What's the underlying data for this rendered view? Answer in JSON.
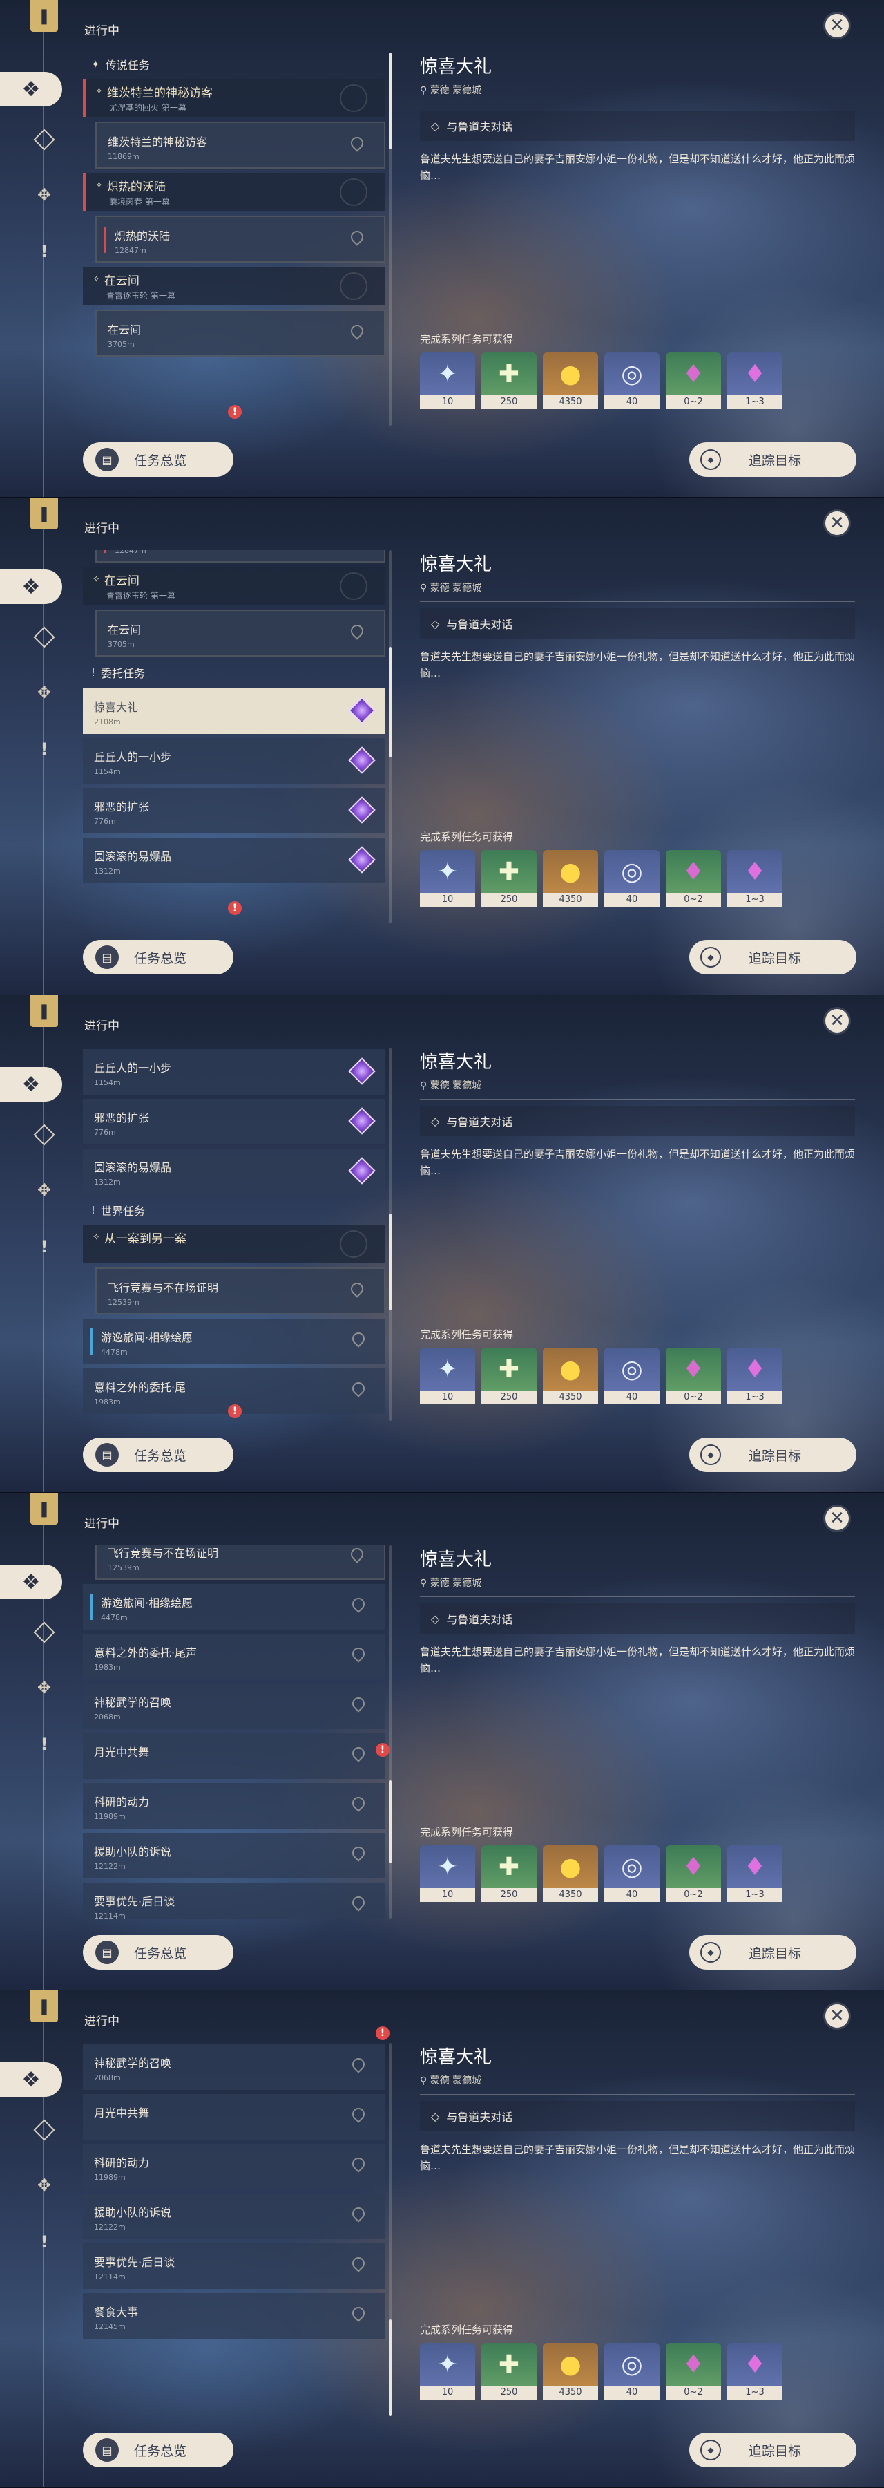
{
  "header": {
    "status_title": "进行中"
  },
  "sections": {
    "legend": "传说任务",
    "commission": "委托任务",
    "world": "世界任务"
  },
  "quests": {
    "vennessa": {
      "title": "维茨特兰的神秘访客",
      "sub": "尤涅基的回火 第一幕",
      "item": "维茨特兰的神秘访客",
      "dist": "11869m"
    },
    "scorching": {
      "title": "炽热的沃陆",
      "sub": "蘑境茵春 第一幕",
      "item": "炽热的沃陆",
      "dist": "12847m"
    },
    "cloud": {
      "title": "在云间",
      "sub": "青霄逐玉轮 第一幕",
      "item": "在云间",
      "dist": "3705m"
    },
    "surprise": {
      "title": "惊喜大礼",
      "dist": "2108m"
    },
    "hilichurl": {
      "title": "丘丘人的一小步",
      "dist": "1154m"
    },
    "evil": {
      "title": "邪恶的扩张",
      "dist": "776m"
    },
    "boom": {
      "title": "圆滚滚的易爆品",
      "dist": "1312m"
    },
    "case": {
      "title": "从一案到另一案"
    },
    "flight": {
      "title": "飞行竞赛与不在场证明",
      "dist": "12539m"
    },
    "travel": {
      "title": "游逸旅闻·相缘绘愿",
      "dist": "4478m"
    },
    "unexpected": {
      "title": "意料之外的委托·尾声",
      "title_cut": "意料之外的委托·尾",
      "dist": "1983m"
    },
    "martial": {
      "title": "神秘武学的召唤",
      "dist": "2068m"
    },
    "moon": {
      "title": "月光中共舞"
    },
    "research": {
      "title": "科研的动力",
      "dist": "11989m"
    },
    "aid": {
      "title": "援助小队的诉说",
      "dist": "12122m"
    },
    "priority": {
      "title": "要事优先·后日谈",
      "title_cut": "要事优先·后日谈",
      "dist": "12114m"
    },
    "feast": {
      "title": "餐食大事",
      "dist": "12145m"
    }
  },
  "detail": {
    "title": "惊喜大礼",
    "location": "蒙德 蒙德城",
    "objective": "与鲁道夫对话",
    "description": "鲁道夫先生想要送自己的妻子吉丽安娜小姐一份礼物，但是却不知道送什么才好，他正为此而烦恼…",
    "rewards_label": "完成系列任务可获得",
    "rewards": [
      {
        "name": "primogem-icon",
        "amount": "10"
      },
      {
        "name": "adventure-exp-icon",
        "amount": "250"
      },
      {
        "name": "mora-icon",
        "amount": "4350"
      },
      {
        "name": "companionship-exp-icon",
        "amount": "40"
      },
      {
        "name": "crystal-icon",
        "amount": "0~2"
      },
      {
        "name": "crystal-cluster-icon",
        "amount": "1~3"
      }
    ]
  },
  "buttons": {
    "overview": "任务总览",
    "track": "追踪目标"
  }
}
